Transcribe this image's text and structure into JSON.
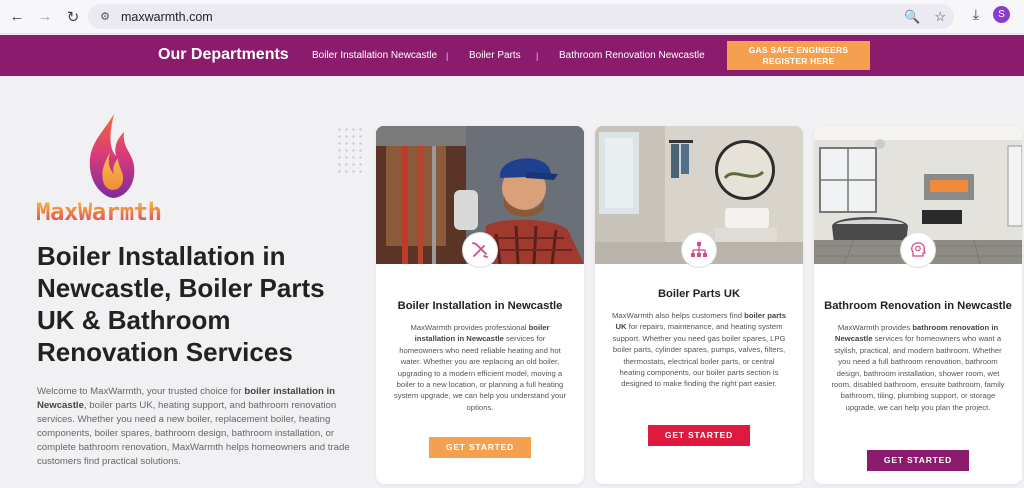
{
  "browser": {
    "url": "maxwarmth.com",
    "back_icon": "back-arrow-icon",
    "forward_icon": "forward-arrow-icon",
    "reload_icon": "reload-icon",
    "profile_initial": "S",
    "profile_color": "#8a3ccf"
  },
  "nav": {
    "title": "Our Departments",
    "links": [
      "Boiler Installation Newcastle",
      "Boiler Parts",
      "Bathroom Renovation Newcastle"
    ],
    "cta": "GAS SAFE ENGINEERS REGISTER HERE",
    "bg_color": "#8b1c6d",
    "cta_color": "#f5a04f"
  },
  "hero": {
    "logo_text": "MaxWarmth",
    "title": "Boiler Installation in Newcastle, Boiler Parts UK & Bathroom Renovation Services",
    "desc_1": "Welcome to MaxWarmth, your trusted choice for ",
    "desc_bold_1": "boiler installation in Newcastle",
    "desc_2": ", boiler parts UK, heating support, and bathroom renovation services. Whether you need a new boiler, replacement boiler, heating components, boiler spares, bathroom design, bathroom installation, or complete bathroom renovation, MaxWarmth helps homeowners and trade customers find practical solutions."
  },
  "cards": [
    {
      "icon": "tools-icon",
      "title": "Boiler Installation in Newcastle",
      "body_1": "MaxWarmth provides professional ",
      "body_bold": "boiler installation in Newcastle",
      "body_2": " services for homeowners who need reliable heating and hot water. Whether you are replacing an old boiler, upgrading to a modern efficient model, moving a boiler to a new location, or planning a full heating system upgrade, we can help you understand your options.",
      "button": "GET STARTED",
      "button_color": "#f5a04f"
    },
    {
      "icon": "sitemap-icon",
      "title": "Boiler Parts UK",
      "body_1": "MaxWarmth also helps customers find ",
      "body_bold": "boiler parts UK",
      "body_2": " for repairs, maintenance, and heating system support. Whether you need gas boiler spares, LPG boiler parts, cylinder spares, pumps, valves, filters, thermostats, electrical boiler parts, or central heating components, our boiler parts section is designed to make finding the right part easier.",
      "button": "GET STARTED",
      "button_color": "#e0193f"
    },
    {
      "icon": "head-gear-icon",
      "title": "Bathroom Renovation in Newcastle",
      "body_1": "MaxWarmth provides ",
      "body_bold": "bathroom renovation in Newcastle",
      "body_2": " services for homeowners who want a stylish, practical, and modern bathroom. Whether you need a full bathroom renovation, bathroom design, bathroom installation, shower room, wet room, disabled bathroom, ensuite bathroom, family bathroom, tiling, plumbing support, or storage upgrade, we can help you plan the project.",
      "button": "GET STARTED",
      "button_color": "#8b1c6d"
    }
  ]
}
